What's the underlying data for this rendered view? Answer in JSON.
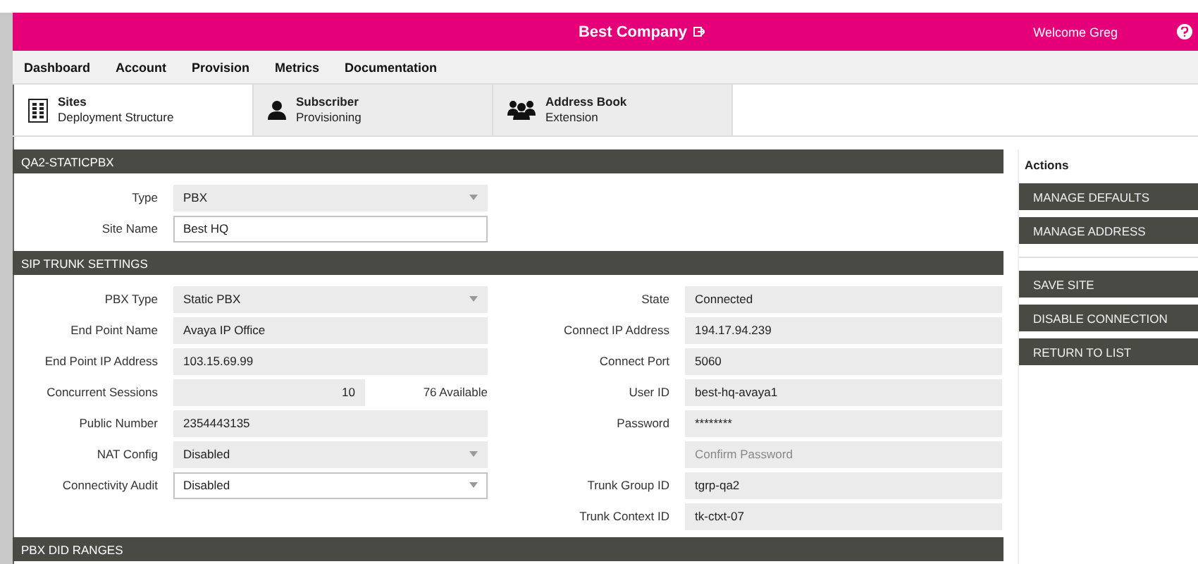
{
  "header": {
    "company": "Best Company",
    "welcome": "Welcome Greg"
  },
  "menu": [
    "Dashboard",
    "Account",
    "Provision",
    "Metrics",
    "Documentation"
  ],
  "tabs": [
    {
      "kind": "building",
      "title": "Sites",
      "subtitle": "Deployment Structure",
      "selected": true
    },
    {
      "kind": "person",
      "title": "Subscriber",
      "subtitle": "Provisioning",
      "selected": false
    },
    {
      "kind": "people",
      "title": "Address Book",
      "subtitle": "Extension",
      "selected": false
    }
  ],
  "site_section": {
    "title": "QA2-STATICPBX",
    "fields": [
      {
        "label": "Type",
        "kind": "select",
        "value": "PBX",
        "disabled": true
      },
      {
        "label": "Site Name",
        "value": "Best HQ",
        "disabled": false
      }
    ]
  },
  "sip_section": {
    "title": "SIP TRUNK SETTINGS",
    "left_fields": [
      {
        "label": "PBX Type",
        "kind": "select",
        "value": "Static PBX",
        "disabled": true
      },
      {
        "label": "End Point Name",
        "value": "Avaya IP Office",
        "disabled": true
      },
      {
        "label": "End Point IP Address",
        "value": "103.15.69.99",
        "disabled": true
      },
      {
        "label": "Concurrent Sessions",
        "kind": "number",
        "value": "10",
        "note": "76 Available",
        "disabled": true
      },
      {
        "label": "Public Number",
        "value": "2354443135",
        "disabled": true
      },
      {
        "label": "NAT Config",
        "kind": "select",
        "value": "Disabled",
        "disabled": true
      },
      {
        "label": "Connectivity Audit",
        "kind": "select",
        "value": "Disabled",
        "disabled": false
      }
    ],
    "right_fields": [
      {
        "label": "State",
        "value": "Connected",
        "disabled": true
      },
      {
        "label": "Connect IP Address",
        "value": "194.17.94.239",
        "disabled": true
      },
      {
        "label": "Connect Port",
        "value": "5060",
        "disabled": true
      },
      {
        "label": "User ID",
        "value": "best-hq-avaya1",
        "disabled": true
      },
      {
        "label": "Password",
        "value": "********",
        "disabled": true
      },
      {
        "placeholder": "Confirm Password",
        "disabled": true
      },
      {
        "label": "Trunk Group ID",
        "value": "tgrp-qa2",
        "disabled": true
      },
      {
        "label": "Trunk Context ID",
        "value": "tk-ctxt-07",
        "disabled": true
      }
    ]
  },
  "did_section": {
    "title": "PBX DID RANGES"
  },
  "actions": {
    "title": "Actions",
    "groups": [
      [
        "MANAGE DEFAULTS",
        "MANAGE ADDRESS"
      ],
      [
        "SAVE SITE",
        "DISABLE CONNECTION",
        "RETURN TO LIST"
      ]
    ]
  }
}
